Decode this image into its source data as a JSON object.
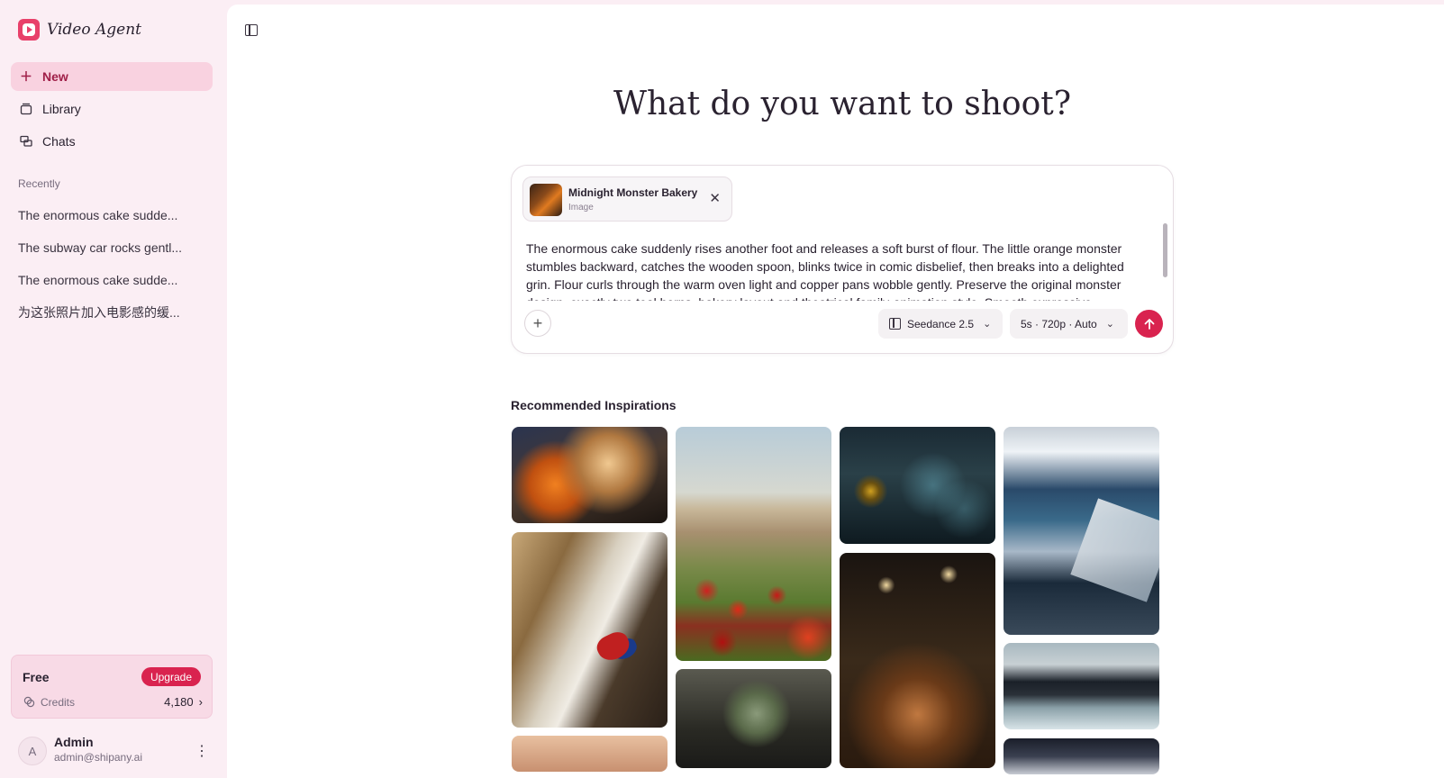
{
  "app": {
    "name": "Video Agent"
  },
  "nav": {
    "new_label": "New",
    "library_label": "Library",
    "chats_label": "Chats"
  },
  "recent": {
    "title": "Recently",
    "items": [
      "The enormous cake sudde...",
      "The subway car rocks gentl...",
      "The enormous cake sudde...",
      "为这张照片加入电影感的缓..."
    ]
  },
  "plan": {
    "name": "Free",
    "upgrade_label": "Upgrade",
    "credits_label": "Credits",
    "credits_value": "4,180"
  },
  "user": {
    "initial": "A",
    "name": "Admin",
    "email": "admin@shipany.ai"
  },
  "main": {
    "headline": "What do you want to shoot?",
    "attachment": {
      "title": "Midnight Monster Bakery",
      "type": "Image"
    },
    "prompt": "The enormous cake suddenly rises another foot and releases a soft burst of flour. The little orange monster stumbles backward, catches the wooden spoon, blinks twice in comic disbelief, then breaks into a delighted grin. Flour curls through the warm oven light and copper pans wobble gently. Preserve the original monster design, exactly two teal horns, bakery layout and theatrical family-animation style. Smooth expressive",
    "model": "Seedance 2.5",
    "params": "5s · 720p · Auto",
    "inspirations_title": "Recommended Inspirations"
  },
  "colors": {
    "accent": "#d9234f",
    "sidebar_bg": "#fbeef4",
    "active_bg": "#f9d2e0"
  }
}
